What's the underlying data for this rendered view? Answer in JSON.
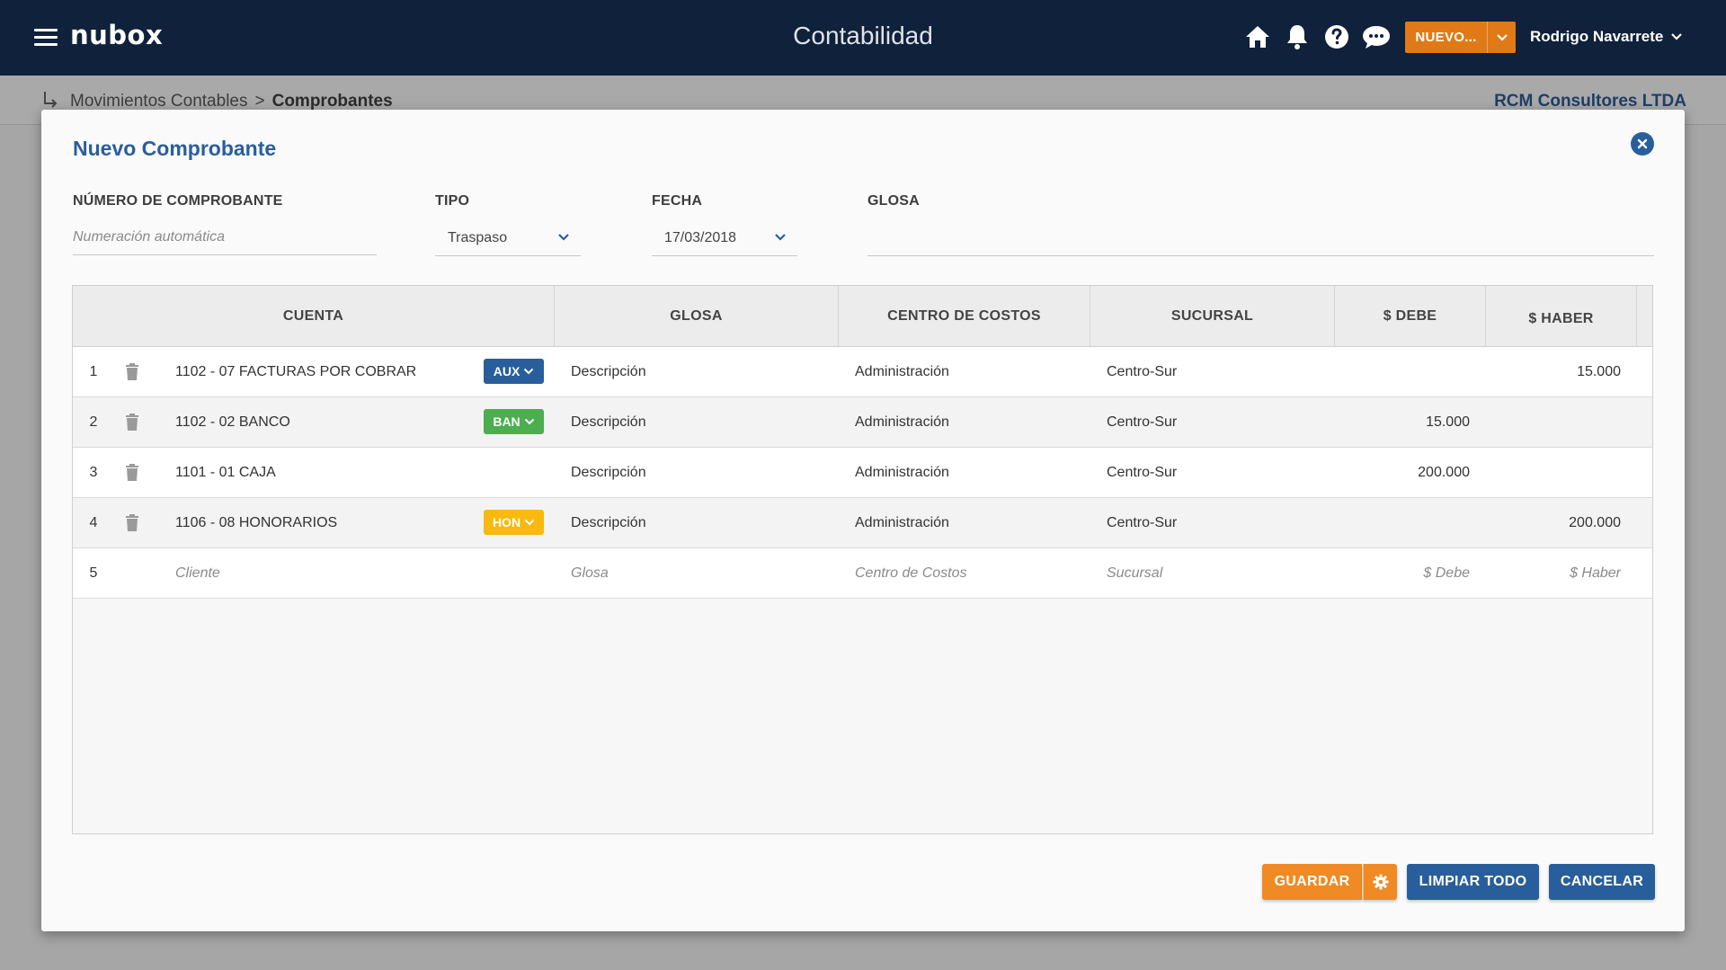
{
  "topbar": {
    "logo": "nubox",
    "app_title": "Contabilidad",
    "nuevo_label": "NUEVO...",
    "user_name": "Rodrigo Navarrete"
  },
  "breadcrumb": {
    "parent": "Movimientos Contables",
    "separator": ">",
    "current": "Comprobantes",
    "company": "RCM Consultores LTDA"
  },
  "modal": {
    "title": "Nuevo Comprobante",
    "fields": {
      "numero_label": "NÚMERO DE COMPROBANTE",
      "numero_placeholder": "Numeración automática",
      "tipo_label": "TIPO",
      "tipo_value": "Traspaso",
      "fecha_label": "FECHA",
      "fecha_value": "17/03/2018",
      "glosa_label": "GLOSA",
      "glosa_value": ""
    },
    "table": {
      "headers": [
        "CUENTA",
        "GLOSA",
        "CENTRO DE COSTOS",
        "SUCURSAL",
        "$ DEBE",
        "$ HABER"
      ],
      "rows": [
        {
          "num": "1",
          "cuenta": "1102 - 07 FACTURAS POR COBRAR",
          "tag": "AUX",
          "glosa": "Descripción",
          "centro": "Administración",
          "sucursal": "Centro-Sur",
          "debe": "",
          "haber": "15.000"
        },
        {
          "num": "2",
          "cuenta": "1102 - 02 BANCO",
          "tag": "BAN",
          "glosa": "Descripción",
          "centro": "Administración",
          "sucursal": "Centro-Sur",
          "debe": "15.000",
          "haber": ""
        },
        {
          "num": "3",
          "cuenta": "1101 - 01 CAJA",
          "tag": "",
          "glosa": "Descripción",
          "centro": "Administración",
          "sucursal": "Centro-Sur",
          "debe": "200.000",
          "haber": ""
        },
        {
          "num": "4",
          "cuenta": "1106 - 08 HONORARIOS",
          "tag": "HON",
          "glosa": "Descripción",
          "centro": "Administración",
          "sucursal": "Centro-Sur",
          "debe": "",
          "haber": "200.000"
        }
      ],
      "new_row": {
        "num": "5",
        "cuenta": "Cliente",
        "glosa": "Glosa",
        "centro": "Centro de Costos",
        "sucursal": "Sucursal",
        "debe": "$ Debe",
        "haber": "$ Haber"
      }
    },
    "buttons": {
      "guardar": "GUARDAR",
      "limpiar": "LIMPIAR TODO",
      "cancelar": "CANCELAR"
    }
  },
  "colors": {
    "topbar": "#0f213b",
    "accent_orange": "#f08a24",
    "accent_blue": "#295e9c",
    "tag_green": "#4cae4f",
    "tag_yellow": "#f9b90f"
  },
  "icons": [
    "menu-icon",
    "home-icon",
    "bell-icon",
    "help-icon",
    "chat-icon",
    "chevron-down-icon",
    "return-arrow-icon",
    "close-icon",
    "trash-icon",
    "gear-icon"
  ]
}
